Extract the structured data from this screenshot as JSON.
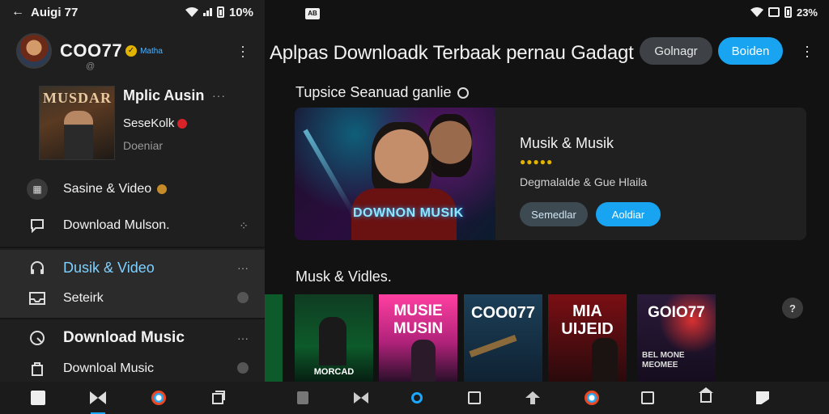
{
  "left": {
    "status": {
      "title": "Auigi 77",
      "battery": "10%"
    },
    "profile": {
      "name": "COO77",
      "sub": "@",
      "tag": "Matha"
    },
    "now_playing": {
      "album_title": "MUSDAR",
      "title": "Mplic Ausin",
      "subtitle": "SeseKolk",
      "subtitle2": "Doeniar"
    },
    "menu": {
      "item1": "Sasine & Video",
      "item2": "Download Mulson.",
      "item3": "Dusik & Video",
      "item4": "Seteirk",
      "item5": "Download Music",
      "item6": "Downloal Music"
    }
  },
  "right": {
    "status": {
      "app_badge": "AB",
      "battery": "23%"
    },
    "header": {
      "title": "Aplpas Downloadk Terbaak pernau Gadagt",
      "btn1": "Golnagr",
      "btn2": "Boiden"
    },
    "section1": {
      "title": "Tupsice Seanuad ganlie"
    },
    "feature": {
      "image_text": "DOWNON MUSIK",
      "title": "Musik & Musik",
      "stars": "●●●●●",
      "desc": "Degmalalde & Gue Hlaila",
      "btn1": "Semedlar",
      "btn2": "Aoldiar"
    },
    "section2": {
      "title": "Musk & Vidles."
    },
    "thumbnails": [
      {
        "text": "MORCAD",
        "bg": "#0d5a2a"
      },
      {
        "text": "MUSIE MUSIN",
        "bg": "#ff3fa1"
      },
      {
        "text": "COO077",
        "bg": "#1c3f57"
      },
      {
        "text": "MIA UIJEID",
        "bg": "#7a0f14"
      },
      {
        "text": "GOIO77",
        "bg": "#2a1a3a",
        "subtext": "BEL MONE MEOMEE"
      }
    ],
    "help": "?"
  },
  "colors": {
    "accent_blue": "#19a4f2",
    "panel_left": "#1f1f1f",
    "panel_right": "#121212"
  }
}
